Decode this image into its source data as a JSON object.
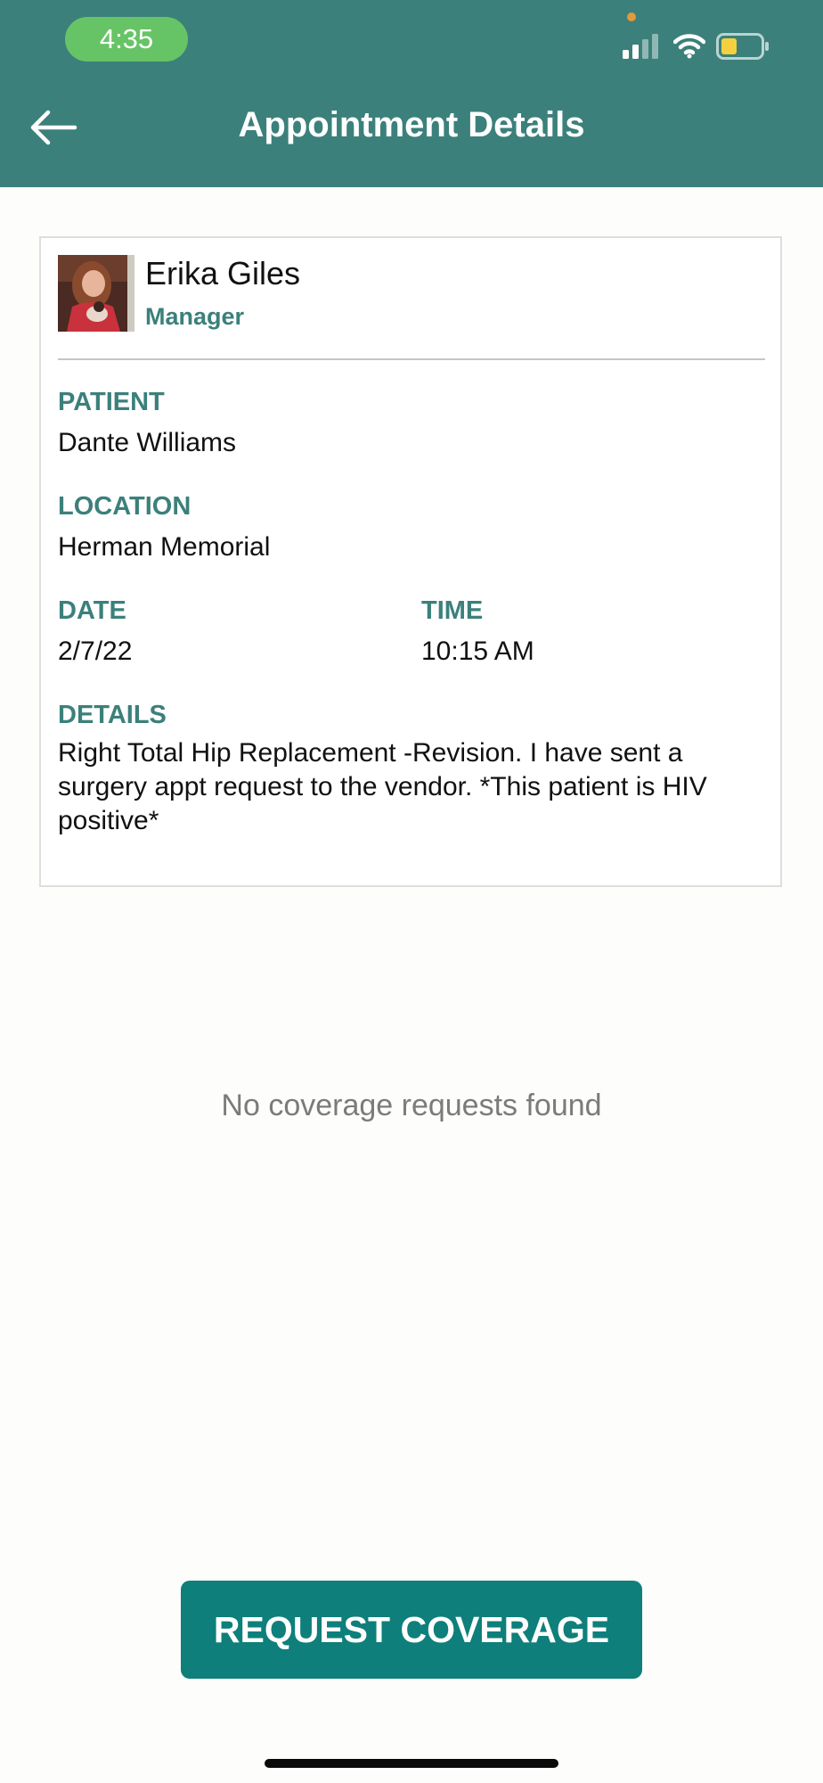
{
  "status_bar": {
    "time": "4:35"
  },
  "header": {
    "title": "Appointment Details",
    "back_icon": "arrow-left-icon"
  },
  "person": {
    "name": "Erika Giles",
    "role": "Manager"
  },
  "appointment": {
    "patient_label": "PATIENT",
    "patient_value": "Dante Williams",
    "location_label": "LOCATION",
    "location_value": "Herman Memorial",
    "date_label": "DATE",
    "date_value": "2/7/22",
    "time_label": "TIME",
    "time_value": "10:15 AM",
    "details_label": "DETAILS",
    "details_value": "Right Total Hip Replacement -Revision. I have sent a surgery appt request to the vendor. *This patient is HIV positive*"
  },
  "coverage": {
    "empty_message": "No coverage requests found",
    "button_label": "REQUEST COVERAGE"
  },
  "colors": {
    "header_bg": "#3b807b",
    "accent": "#3b807b",
    "button_bg": "#0e7f7b",
    "time_pill": "#67c466"
  }
}
